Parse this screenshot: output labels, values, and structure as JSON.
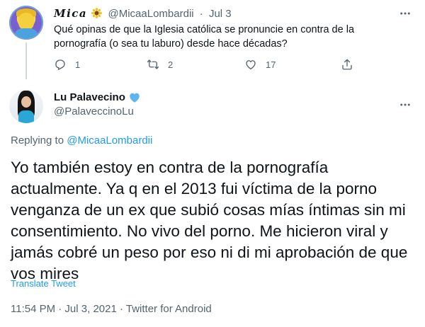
{
  "reply_tweet": {
    "author_name": "Mica",
    "author_handle": "@MicaaLombardii",
    "separator": "·",
    "date": "Jul 3",
    "text": "Qué opinas de que la Iglesia católica se pronuncie en contra de la pornografía (o sea tu laburo) desde hace décadas?",
    "replies_count": "1",
    "retweets_count": "2",
    "likes_count": "17",
    "icons": {
      "name_emoji": "sunflower-icon",
      "more": "more-icon",
      "reply": "reply-icon",
      "retweet": "retweet-icon",
      "like": "like-icon",
      "share": "share-icon"
    }
  },
  "main_tweet": {
    "author_name": "Lu Palavecino",
    "author_handle": "@PalaveccinoLu",
    "name_badge_icon": "blue-heart-icon",
    "replying_prefix": "Replying to",
    "replying_to": "@MicaaLombardii",
    "text": "Yo también estoy en contra de la pornografía actualmente. Ya q en el 2013 fui víctima de la porno venganza de un ex que subió cosas mías íntimas sin mi consentimiento. No vivo del porno. Me hicieron viral y jamás cobré un peso por eso ni di mi aprobación de que vos mires",
    "translate_label": "Translate Tweet",
    "timestamp": "11:54 PM · Jul 3, 2021 · Twitter for Android"
  },
  "colors": {
    "link": "#1d9bf0",
    "secondary_text": "#536471",
    "primary_text": "#0f1419",
    "heart_badge": "#5cb4f0"
  }
}
